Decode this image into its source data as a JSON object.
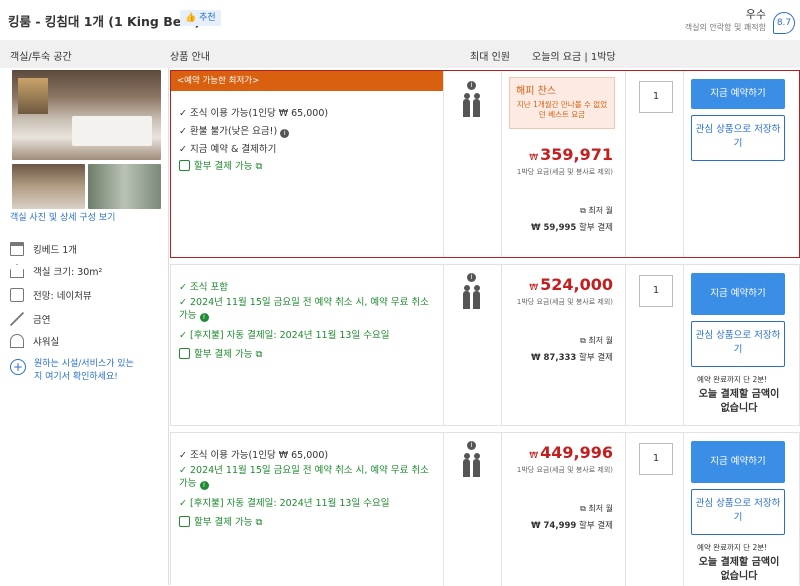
{
  "header": {
    "title": "킹룸 - 킹침대 1개 (1 King Bed )",
    "recommend_label": "추천",
    "rating_word": "우수",
    "rating_sub": "객실의 안락함 및 쾌적함",
    "score": "8.7"
  },
  "columns": {
    "room": "객실/투숙 공간",
    "offer": "상품 안내",
    "max_guests": "최대 인원",
    "today_rate": "오늘의 요금 | 1박당"
  },
  "room": {
    "photo_link": "객실 사진 및 상세 구성 보기",
    "amenities": [
      {
        "icon": "bed-icon",
        "label": "킹베드 1개"
      },
      {
        "icon": "house-icon",
        "label": "객실 크기: 30m²"
      },
      {
        "icon": "view-icon",
        "label": "전망: 네이처뷰"
      },
      {
        "icon": "no-smoking-icon",
        "label": "금연"
      },
      {
        "icon": "shower-icon",
        "label": "샤워실"
      }
    ],
    "ask_link_1": "원하는 시설/서비스가 있는",
    "ask_link_2": "지 여기서 확인하세요!"
  },
  "offers": [
    {
      "banner": "<예약 가능한 최저가>",
      "features": [
        "조식 이용 가능(1인당 ₩ 65,000)",
        "환불 불가(낮은 요금!)",
        "지금 예약 & 결제하기"
      ],
      "installment": "할부 결제 가능",
      "happy_title": "해피 찬스",
      "happy_sub": "지난 1개월간 만나볼 수 없었던 베스트 요금",
      "currency": "₩",
      "price": "359,971",
      "price_note": "1박당 요금(세금 및 봉사료 제외)",
      "min_label": "최저 월",
      "monthly": "₩ 59,995",
      "monthly_suffix": "할부 결제",
      "qty": "1",
      "book": "지금 예약하기",
      "wish": "관심 상품으로 저장하기"
    },
    {
      "features": [
        "조식 포함",
        "2024년 11월 15일 금요일 전 예약 취소 시, 예약 무료 취소 가능",
        "[후지불] 자동 결제일: 2024년 11월 13일 수요일"
      ],
      "installment": "할부 결제 가능",
      "currency": "₩",
      "price": "524,000",
      "price_note": "1박당 요금(세금 및 봉사료 제외)",
      "min_label": "최저 월",
      "monthly": "₩ 87,333",
      "monthly_suffix": "할부 결제",
      "qty": "1",
      "book": "지금 예약하기",
      "wish": "관심 상품으로 저장하기",
      "remain": "예약 완료까지 단 2분!",
      "nopay": "오늘 결제할 금액이 없습니다"
    },
    {
      "features": [
        "조식 이용 가능(1인당 ₩ 65,000)",
        "2024년 11월 15일 금요일 전 예약 취소 시, 예약 무료 취소 가능",
        "[후지불] 자동 결제일: 2024년 11월 13일 수요일"
      ],
      "installment": "할부 결제 가능",
      "currency": "₩",
      "price": "449,996",
      "price_note": "1박당 요금(세금 및 봉사료 제외)",
      "min_label": "최저 월",
      "monthly": "₩ 74,999",
      "monthly_suffix": "할부 결제",
      "qty": "1",
      "book": "지금 예약하기",
      "wish": "관심 상품으로 저장하기",
      "remain": "예약 완료까지 단 2분!",
      "nopay": "오늘 결제할 금액이 없습니다"
    }
  ]
}
